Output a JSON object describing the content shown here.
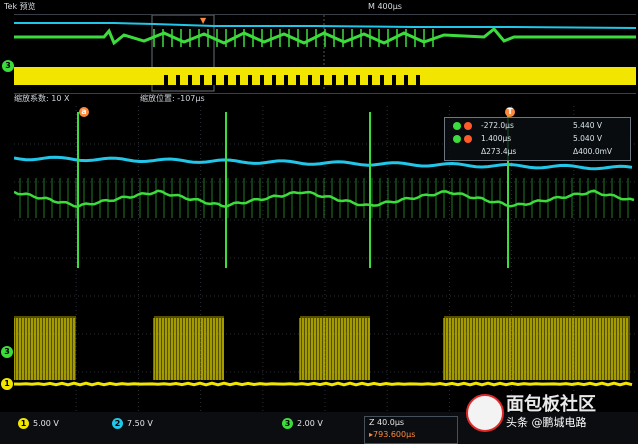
{
  "header": {
    "title": "Tek 预览",
    "timebase": "M 400μs"
  },
  "zoom": {
    "factor_label": "缩放系数: 10 X",
    "position_label": "缩放位置: -107μs"
  },
  "measurements": {
    "rows": [
      {
        "left": "-272.0μs",
        "right": "5.440 V"
      },
      {
        "left": "1.400μs",
        "right": "5.040 V"
      },
      {
        "left": "Δ273.4μs",
        "right": "Δ400.0mV"
      }
    ]
  },
  "channels": [
    {
      "id": "1",
      "scale": "5.00 V",
      "color": "#f2e600"
    },
    {
      "id": "2",
      "scale": "7.50 V",
      "color": "#22c6e8"
    },
    {
      "id": "3",
      "scale": "2.00 V",
      "color": "#3ddc3d"
    }
  ],
  "time_box": {
    "time": "Z 40.0μs",
    "trigger": "▸793.600μs"
  },
  "markers": {
    "ch1": "1",
    "ch2": "2",
    "ch3": "3",
    "trigger_t": "T",
    "cursor": "a"
  },
  "watermark": {
    "site": "面包板社区",
    "author": "头条 @鹏城电路"
  },
  "colors": {
    "ch1": "#f2e600",
    "ch2": "#22c6e8",
    "ch3": "#3ddc3d",
    "trigger": "#ff8a3d"
  }
}
